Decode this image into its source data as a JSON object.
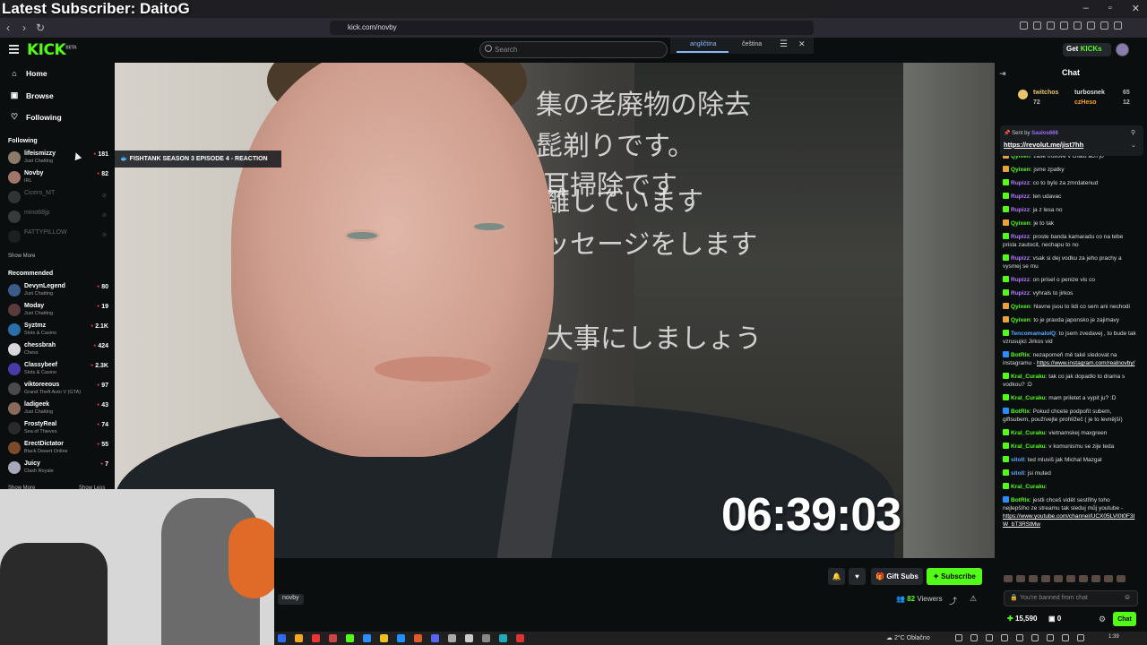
{
  "overlay": {
    "title": "Latest Subscriber: DaitoG"
  },
  "browser": {
    "url": "kick.com/novby"
  },
  "header": {
    "logo": "KICK",
    "logo_sup": "BETA",
    "search_placeholder": "Search",
    "translate": {
      "lang_from": "angličtina",
      "lang_to": "čeština"
    },
    "get_kicks_prefix": "Get ",
    "get_kicks_brand": "KICKs"
  },
  "sidebar": {
    "nav": [
      {
        "label": "Home",
        "icon": "home-icon"
      },
      {
        "label": "Browse",
        "icon": "browse-icon"
      },
      {
        "label": "Following",
        "icon": "heart-icon"
      }
    ],
    "following_title": "Following",
    "following": [
      {
        "name": "lifeismizzy",
        "category": "Just Chatting",
        "viewers": "181",
        "live": true,
        "avatar_color": "#8b7b6a"
      },
      {
        "name": "Novby",
        "category": "IRL",
        "viewers": "82",
        "live": true,
        "avatar_color": "#a0756a"
      },
      {
        "name": "Cicero_MT",
        "category": "",
        "viewers": "",
        "live": false,
        "avatar_color": "#6b6b6b"
      },
      {
        "name": "mino88jp",
        "category": "",
        "viewers": "",
        "live": false,
        "avatar_color": "#7a7a7a"
      },
      {
        "name": "FATTYPILLOW",
        "category": "",
        "viewers": "",
        "live": false,
        "avatar_color": "#3a3a3a"
      }
    ],
    "show_more": "Show More",
    "recommended_title": "Recommended",
    "recommended": [
      {
        "name": "DevynLegend",
        "category": "Just Chatting",
        "viewers": "80",
        "avatar_color": "#3b5b8c"
      },
      {
        "name": "Moday",
        "category": "Just Chatting",
        "viewers": "19",
        "avatar_color": "#5a3a3a"
      },
      {
        "name": "Syztmz",
        "category": "Slots & Casino",
        "viewers": "2.1K",
        "avatar_color": "#2a6ea8"
      },
      {
        "name": "chessbrah",
        "category": "Chess",
        "viewers": "424",
        "avatar_color": "#d8d8d8"
      },
      {
        "name": "Classybeef",
        "category": "Slots & Casino",
        "viewers": "2.3K",
        "avatar_color": "#4a3aa8"
      },
      {
        "name": "viktoreeous",
        "category": "Grand Theft Auto V (GTA)",
        "viewers": "97",
        "avatar_color": "#4a4a4a"
      },
      {
        "name": "ladigeek",
        "category": "Just Chatting",
        "viewers": "43",
        "avatar_color": "#8a6a5a"
      },
      {
        "name": "FrostyReal",
        "category": "Sea of Thieves",
        "viewers": "74",
        "avatar_color": "#2a2a2a"
      },
      {
        "name": "ErectDictator",
        "category": "Black Desert Online",
        "viewers": "55",
        "avatar_color": "#7a4a2a"
      },
      {
        "name": "Juicy",
        "category": "Clash Royale",
        "viewers": "7",
        "avatar_color": "#a8a8b8"
      }
    ],
    "show_more_bottom": "Show More",
    "show_less": "Show Less"
  },
  "video": {
    "stream_title": "FISHTANK SEASON 3 EPISODE 4 - REACTION",
    "timer": "06:39:03",
    "sign_lines": [
      "集の老廃物の除去",
      "髭剃りです。",
      "耳掃除です",
      "離しています",
      "ッセージをします",
      "大事にしましょう"
    ]
  },
  "under_video": {
    "channel_tag": "novby",
    "gift_subs": "Gift Subs",
    "subscribe": "Subscribe",
    "viewers_count": "82",
    "viewers_label": "Viewers"
  },
  "chat": {
    "title": "Chat",
    "leaderboard": [
      {
        "name": "twitchos",
        "value": "72",
        "color": "#e9c46a"
      },
      {
        "name": "turbosnek",
        "value": "65",
        "color": "#ddd"
      },
      {
        "name": "czHeso",
        "value": "12",
        "color": "#f5a623"
      }
    ],
    "pinned": {
      "sent_by_label": "Sent by",
      "sender": "Saulos666",
      "link": "https://revolut.me/jist7hh"
    },
    "messages": [
      {
        "user": "Qyixen",
        "color": "#53fc18",
        "text": "zase trollove v chatu ach jo"
      },
      {
        "user": "Qyixen",
        "color": "#53fc18",
        "text": "jsme zpatky"
      },
      {
        "user": "Rupizz",
        "color": "#b57bff",
        "text": "co to bylo za zmrdatenud"
      },
      {
        "user": "Rupizz",
        "color": "#b57bff",
        "text": "ten udavac"
      },
      {
        "user": "Rupizz",
        "color": "#b57bff",
        "text": "ja z lesa no"
      },
      {
        "user": "Qyixen",
        "color": "#53fc18",
        "text": "je to tak"
      },
      {
        "user": "Rupizz",
        "color": "#b57bff",
        "text": "proste banda kamaradu co na tebe prisla zautocit, nechapu to no"
      },
      {
        "user": "Rupizz",
        "color": "#b57bff",
        "text": "vsak si dej vodku za jeho prachy a vysmej se mu"
      },
      {
        "user": "Rupizz",
        "color": "#b57bff",
        "text": "on prisel o penize vis co"
      },
      {
        "user": "Rupizz",
        "color": "#b57bff",
        "text": "vyhrals to jirkos"
      },
      {
        "user": "Qyixen",
        "color": "#53fc18",
        "text": "hlavne jsou to lidi co sem ani nechodi"
      },
      {
        "user": "Qyixen",
        "color": "#53fc18",
        "text": "to je pravda japonsko je zajimavy"
      },
      {
        "user": "TencomamaloIQ",
        "color": "#5aa6ff",
        "text": "to jsem zvedavej , to bude tak vzrusujici Jirkos vid"
      },
      {
        "user": "BotRix",
        "color": "#53fc18",
        "text": "nezapomeň mě také sledovat na instagramu - ",
        "link": "https://www.instagram.com/realnovby/"
      },
      {
        "user": "Kral_Curaku",
        "color": "#53fc18",
        "text": "tak co jak dopadlo to drama s vodkou? :D"
      },
      {
        "user": "Kral_Curaku",
        "color": "#53fc18",
        "text": "mam priletet a vypit ju? :D"
      },
      {
        "user": "BotRix",
        "color": "#53fc18",
        "text": "Pokud chcete podpořit subem, giftsubem, používejte prohlížeč ( je to levnější)"
      },
      {
        "user": "Kral_Curaku",
        "color": "#53fc18",
        "text": "vietnamskej maxgreen"
      },
      {
        "user": "Kral_Curaku",
        "color": "#53fc18",
        "text": "v komunismu se zije teda"
      },
      {
        "user": "sitoll",
        "color": "#5aa6ff",
        "text": "ted mluviš jak Michal Mazgal"
      },
      {
        "user": "sitoll",
        "color": "#5aa6ff",
        "text": "jsi muted"
      },
      {
        "user": "Kral_Curaku",
        "color": "#53fc18",
        "text": ""
      },
      {
        "user": "BotRix",
        "color": "#53fc18",
        "text": "jestli chceš vidět sestřihy toho nejlepšího ze streamu tak sleduj můj youtube - ",
        "link": "https://www.youtube.com/channel/UCX05LVI0t0F3IW_bT3RStMw"
      }
    ],
    "input_placeholder": "You're banned from chat",
    "points": "15,590",
    "kicks": "0",
    "send": "Chat"
  },
  "taskbar": {
    "weather": "2°C  Oblačno",
    "clock": "1:39"
  }
}
